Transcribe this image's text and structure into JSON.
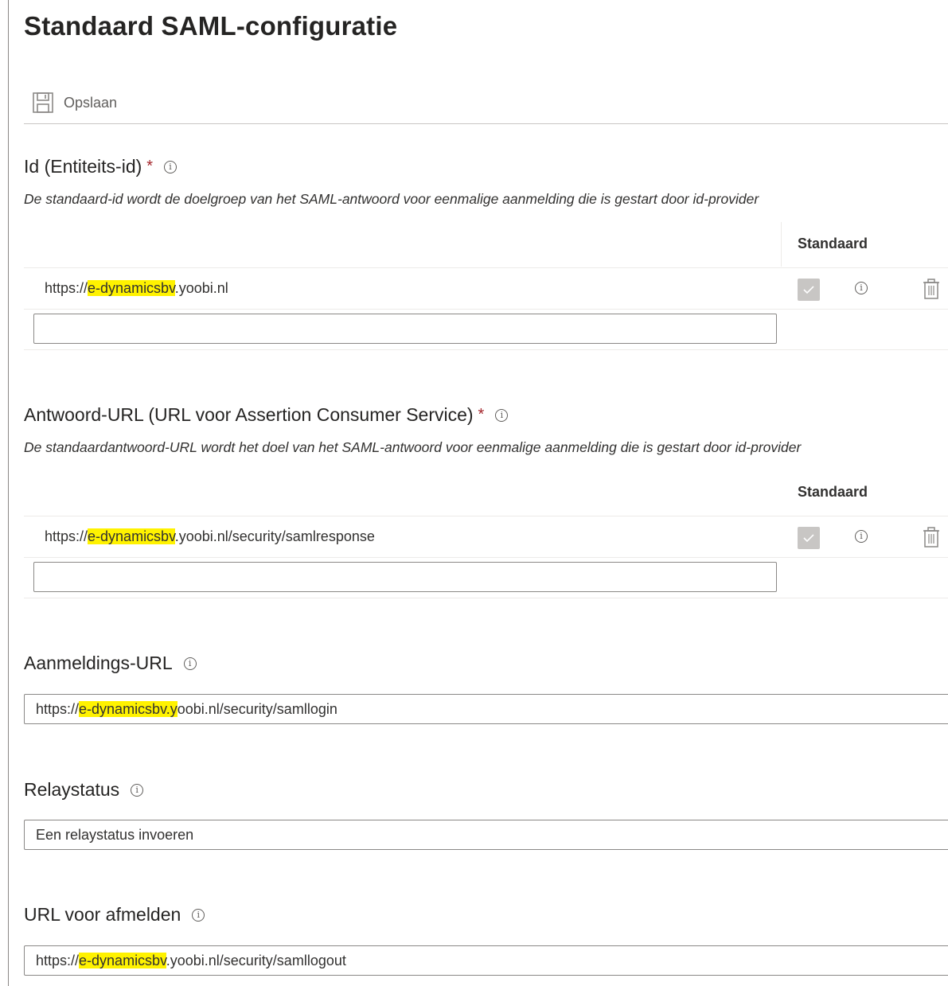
{
  "page": {
    "title": "Standaard SAML-configuratie"
  },
  "toolbar": {
    "save_label": "Opslaan"
  },
  "identifier": {
    "label": "Id (Entiteits-id)",
    "required_mark": "*",
    "description": "De standaard-id wordt de doelgroep van het SAML-antwoord voor eenmalige aanmelding die is gestart door id-provider",
    "column_default": "Standaard",
    "row": {
      "url_prefix": "https://",
      "url_highlight": "e-dynamicsbv",
      "url_suffix": ".yoobi.nl",
      "default_checked": true
    },
    "new_value": ""
  },
  "reply_url": {
    "label": "Antwoord-URL (URL voor Assertion Consumer Service)",
    "required_mark": "*",
    "description": "De standaardantwoord-URL wordt het doel van het SAML-antwoord voor eenmalige aanmelding die is gestart door id-provider",
    "column_default": "Standaard",
    "row": {
      "url_prefix": "https://",
      "url_highlight": "e-dynamicsbv",
      "url_suffix": ".yoobi.nl/security/samlresponse",
      "default_checked": true
    },
    "new_value": ""
  },
  "sign_on_url": {
    "label": "Aanmeldings-URL",
    "value_prefix": "https://",
    "value_highlight": "e-dynamicsbv.y",
    "value_suffix": "oobi.nl/security/samllogin"
  },
  "relay_state": {
    "label": "Relaystatus",
    "placeholder": "Een relaystatus invoeren"
  },
  "logout_url": {
    "label": "URL voor afmelden",
    "value_prefix": "https://",
    "value_highlight": "e-dynamicsbv",
    "value_suffix": ".yoobi.nl/security/samllogout"
  },
  "colors": {
    "highlight": "#fff200",
    "required": "#a4262c",
    "border": "#8a8886",
    "checkbox": "#c8c6c4"
  }
}
